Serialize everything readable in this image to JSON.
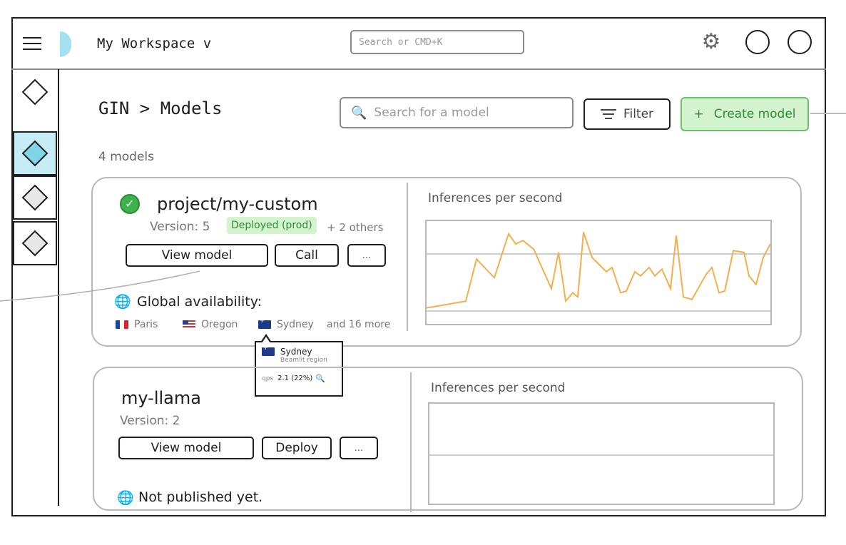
{
  "header": {
    "workspace_title": "My Workspace v",
    "search_placeholder": "Search or CMD+K"
  },
  "page": {
    "breadcrumb": "GIN > Models",
    "model_search_placeholder": "Search for a model",
    "filter_label": "Filter",
    "create_label": "Create model",
    "create_plus": "+",
    "count": "4 models"
  },
  "models": [
    {
      "name": "project/my-custom",
      "version": "Version: 5",
      "badge": "Deployed (prod)",
      "others": "+ 2 others",
      "btn_view": "View model",
      "btn_call": "Call",
      "btn_more": "...",
      "availability": "Global availability:",
      "regions": [
        "Paris",
        "Oregon",
        "Sydney"
      ],
      "more_regions": "and 16 more",
      "chart_title": "Inferences per second"
    },
    {
      "name": "my-llama",
      "version": "Version: 2",
      "btn_view": "View model",
      "btn_deploy": "Deploy",
      "btn_more": "...",
      "availability": "Not published yet.",
      "chart_title": "Inferences per second"
    }
  ],
  "tooltip": {
    "title": "Sydney",
    "subtitle": "Beamlit region",
    "label": "qps",
    "value": "2.1 (22%)"
  },
  "colors": {
    "accent_green": "#69c26a",
    "accent_cyan": "#7fd4e6",
    "chart_line": "#f0b04e"
  },
  "chart_data": {
    "type": "line",
    "series": [
      {
        "values": [
          0.02,
          0.1,
          0.6,
          0.38,
          0.9,
          0.78,
          0.82,
          0.72,
          0.25,
          0.68,
          0.1,
          0.2,
          0.15,
          0.92,
          0.62,
          0.45,
          0.5,
          0.2,
          0.22,
          0.45,
          0.4,
          0.5,
          0.4,
          0.48,
          0.25,
          0.88,
          0.15,
          0.12,
          0.42,
          0.5,
          0.2,
          0.22,
          0.7,
          0.68,
          0.4,
          0.3,
          0.62,
          0.78
        ]
      }
    ]
  }
}
